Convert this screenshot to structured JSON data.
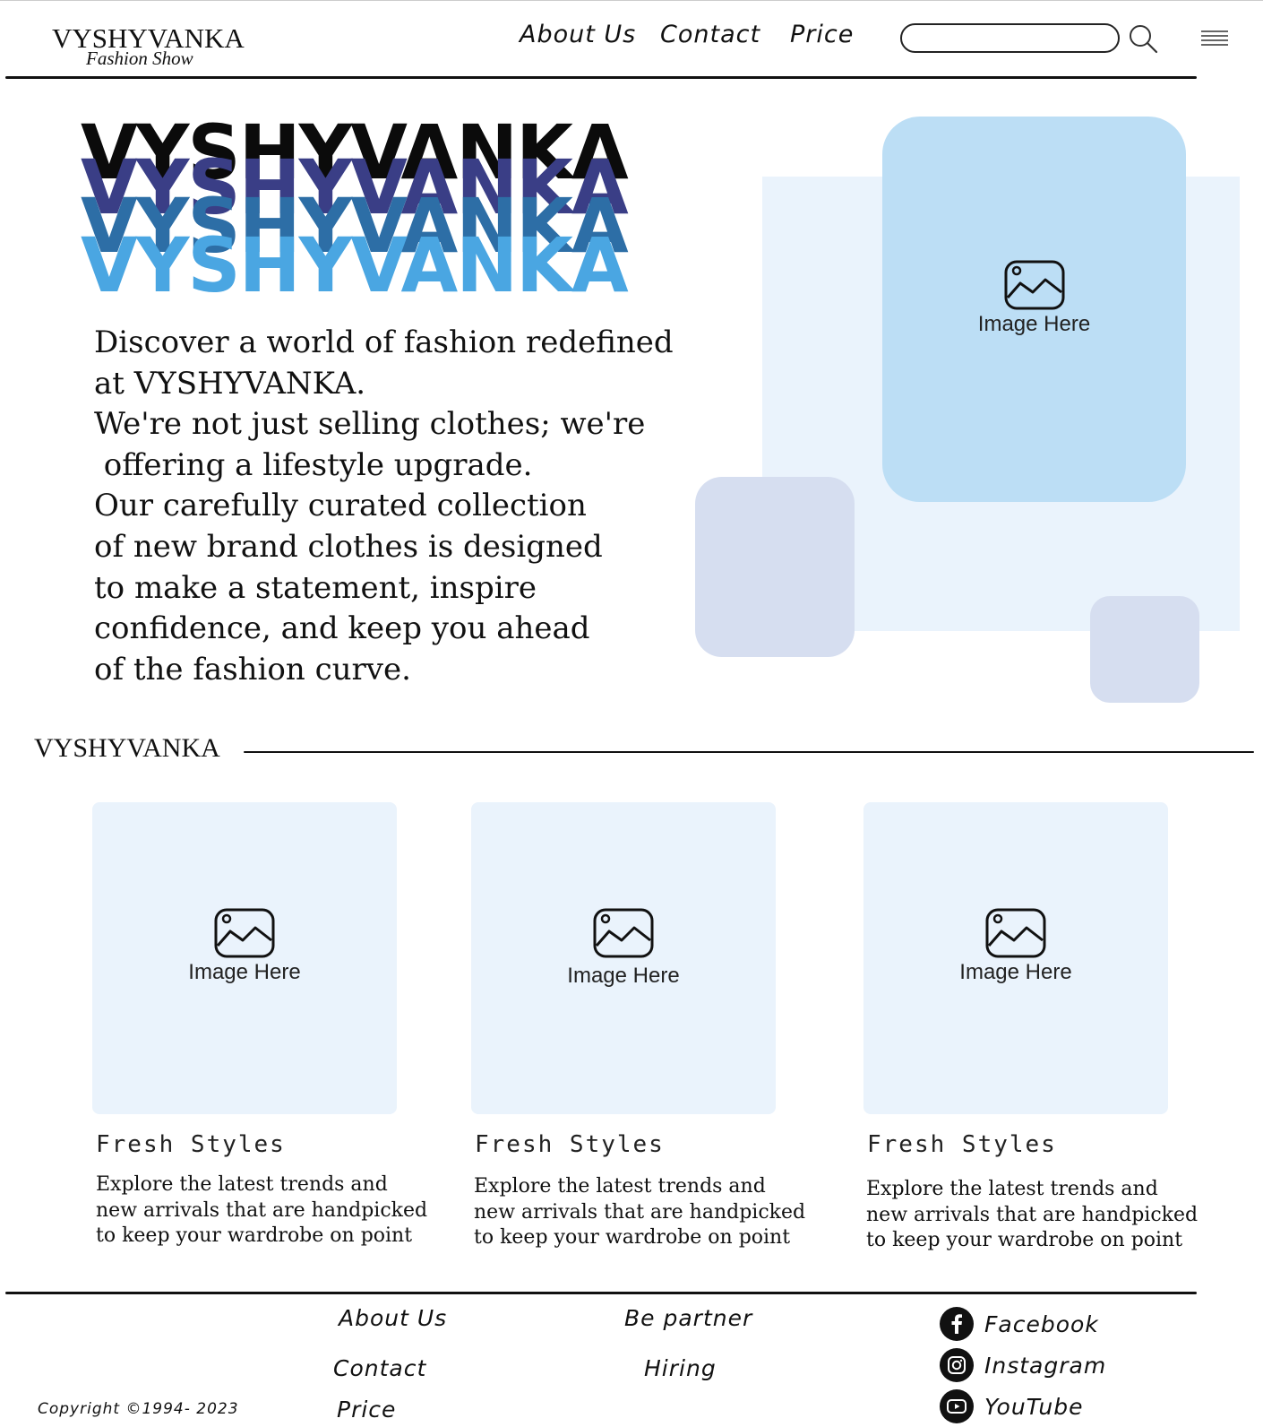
{
  "header": {
    "logo_title": "VYSHYVANKA",
    "logo_subtitle": "Fashion Show",
    "nav": {
      "about": "About Us",
      "contact": "Contact",
      "price": "Price"
    },
    "search_value": ""
  },
  "hero": {
    "wordmark": "VYSHYVANKA",
    "wordmark_colors": [
      "#0b0b0b",
      "#3a3e86",
      "#2d6ea6",
      "#4aa6e2"
    ],
    "text": "Discover a world of fashion redefined\nat VYSHYVANKA.\nWe're not just selling clothes; we're\n offering a lifestyle upgrade.\nOur carefully curated collection\nof new brand clothes is designed\nto make a statement, inspire\nconfidence, and keep you ahead\nof the fashion curve.",
    "image_label": "Image Here"
  },
  "section": {
    "title": "VYSHYVANKA",
    "cards": [
      {
        "image_label": "Image Here",
        "title": "Fresh  Styles",
        "desc_lines": [
          "Explore the latest trends and",
          "new arrivals that are handpicked",
          "to keep your wardrobe on point"
        ]
      },
      {
        "image_label": "Image Here",
        "title": "Fresh  Styles",
        "desc_lines": [
          "Explore the latest trends and",
          "new arrivals that are handpicked",
          "to keep your wardrobe on point"
        ]
      },
      {
        "image_label": "Image Here",
        "title": "Fresh  Styles",
        "desc_lines": [
          "Explore the latest trends and",
          "new arrivals that are handpicked",
          "to keep your wardrobe on point"
        ]
      }
    ]
  },
  "footer": {
    "col1": {
      "about": "About Us",
      "contact": "Contact",
      "price": "Price"
    },
    "col2": {
      "partner": "Be partner",
      "hiring": "Hiring"
    },
    "social": {
      "facebook": "Facebook",
      "instagram": "Instagram",
      "youtube": "YouTube"
    },
    "copyright": "Copyright ©1994- 2023"
  },
  "colors": {
    "image_main": "#bcdef5",
    "panel": "#eaf3fc",
    "deco": "#d6def0"
  }
}
